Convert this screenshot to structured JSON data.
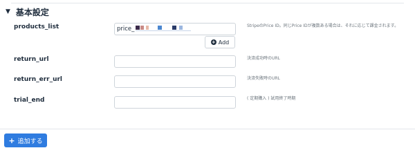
{
  "section": {
    "title": "基本設定"
  },
  "fields": {
    "products_list": {
      "label": "products_list",
      "value": "price_",
      "help": "StripeのPrice ID。同じPrice IDが複数ある場合は、それに応じて課金されます。"
    },
    "return_url": {
      "label": "return_url",
      "value": "",
      "help": "決済成功時のURL"
    },
    "return_err_url": {
      "label": "return_err_url",
      "value": "",
      "help": "決済失敗時のURL"
    },
    "trial_end": {
      "label": "trial_end",
      "value": "",
      "help": "( 定期購入 ) 試用終了時期"
    }
  },
  "buttons": {
    "add_label": "Add",
    "submit_label": "追加する"
  },
  "icons": {
    "collapse": "caret-down-icon",
    "add": "plus-circle-icon",
    "submit": "plus-icon"
  },
  "colors": {
    "primary": "#2f7ce0",
    "text": "#1f2d3d",
    "muted": "#6c757d",
    "border": "#ced4da",
    "redaction": [
      "#3b2a4a",
      "#c98a86",
      "#e7b9a8",
      "#4b87d0",
      "#2a3c6a",
      "#9cb7e0",
      "#dfe7f3"
    ]
  }
}
